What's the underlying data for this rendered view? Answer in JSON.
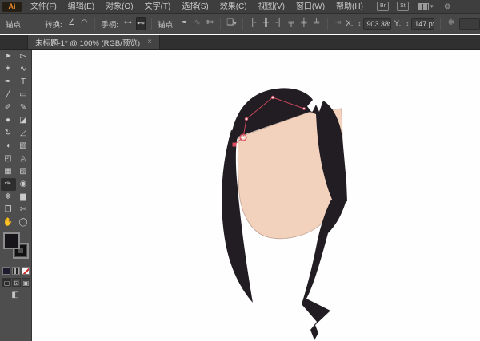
{
  "menubar": {
    "logo": "Ai",
    "items": [
      {
        "label": "文件(F)"
      },
      {
        "label": "编辑(E)"
      },
      {
        "label": "对象(O)"
      },
      {
        "label": "文字(T)"
      },
      {
        "label": "选择(S)"
      },
      {
        "label": "效果(C)"
      },
      {
        "label": "视图(V)"
      },
      {
        "label": "窗口(W)"
      },
      {
        "label": "帮助(H)"
      }
    ],
    "br_button": "Br",
    "st_button": "St"
  },
  "controlbar": {
    "title": "锚点",
    "convert_label": "转换:",
    "handles_label": "手柄:",
    "anchors_label": "锚点:",
    "x_label": "X:",
    "x_value": "903.389",
    "y_label": "Y:",
    "y_value": "147 px",
    "icons": {
      "convert_corner": "∠",
      "convert_smooth": "◠",
      "handles_show": "⊶",
      "handles_hide": "⊷",
      "anchor_remove": "✒",
      "anchor_connect": "∿",
      "anchor_cut": "✄",
      "doc_export": "❏",
      "align": [
        "╟",
        "╫",
        "╢",
        "╤",
        "╪",
        "╧"
      ],
      "isolate": "⇥",
      "transform_star": "✱"
    }
  },
  "tabbar": {
    "title": "未标题-1* @ 100% (RGB/预览)",
    "close": "×"
  },
  "toolbar": {
    "selected_tool": "eyedropper",
    "tools": [
      {
        "name": "selection",
        "glyph": "➤"
      },
      {
        "name": "direct-selection",
        "glyph": "▻"
      },
      {
        "name": "magic-wand",
        "glyph": "✶"
      },
      {
        "name": "lasso",
        "glyph": "∿"
      },
      {
        "name": "pen",
        "glyph": "✒"
      },
      {
        "name": "type",
        "glyph": "T"
      },
      {
        "name": "line-segment",
        "glyph": "╱"
      },
      {
        "name": "rectangle",
        "glyph": "▭"
      },
      {
        "name": "paintbrush",
        "glyph": "✐"
      },
      {
        "name": "pencil",
        "glyph": "✎"
      },
      {
        "name": "blob-brush",
        "glyph": "●"
      },
      {
        "name": "eraser",
        "glyph": "◪"
      },
      {
        "name": "rotate",
        "glyph": "↻"
      },
      {
        "name": "scale",
        "glyph": "◿"
      },
      {
        "name": "width",
        "glyph": "◖"
      },
      {
        "name": "free-transform",
        "glyph": "▧"
      },
      {
        "name": "shape-builder",
        "glyph": "◰"
      },
      {
        "name": "perspective-grid",
        "glyph": "◬"
      },
      {
        "name": "mesh",
        "glyph": "▦"
      },
      {
        "name": "gradient",
        "glyph": "▨"
      },
      {
        "name": "eyedropper",
        "glyph": "✑"
      },
      {
        "name": "blend",
        "glyph": "◉"
      },
      {
        "name": "symbol-sprayer",
        "glyph": "❋"
      },
      {
        "name": "column-graph",
        "glyph": "▆"
      },
      {
        "name": "artboard",
        "glyph": "❐"
      },
      {
        "name": "slice",
        "glyph": "✄"
      },
      {
        "name": "hand",
        "glyph": "✋"
      },
      {
        "name": "zoom",
        "glyph": "◯"
      }
    ],
    "drawing_modes": [
      "▢",
      "⊡",
      "▣"
    ],
    "screen_mode": "◧"
  },
  "icons": {
    "workspace_caret": "▾",
    "cs_live": "❂",
    "spinner": "↕"
  },
  "artwork": {
    "hair_color": "#211d23",
    "skin_color": "#f2d1bd",
    "skin_stroke": "#8f6a59",
    "path_color": "#d84a5e",
    "anchor_fill": "#f6dade"
  }
}
